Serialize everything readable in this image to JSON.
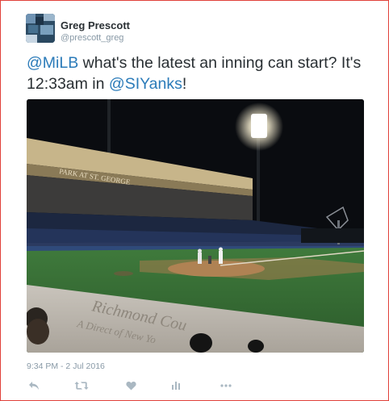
{
  "user": {
    "name": "Greg Prescott",
    "handle": "@prescott_greg"
  },
  "tweet": {
    "segments": [
      {
        "text": "@MiLB",
        "type": "mention"
      },
      {
        "text": " what's the latest an inning can start? It's 12:33am in ",
        "type": "text"
      },
      {
        "text": "@SIYanks",
        "type": "mention"
      },
      {
        "text": "!",
        "type": "text"
      }
    ],
    "timestamp": "9:34 PM - 2 Jul 2016"
  },
  "photo": {
    "stadium_sign": "PARK AT ST. GEORGE",
    "dugout_text_line1": "Richmond Cou",
    "dugout_text_line2": "A Direct of New Yo"
  },
  "actions": [
    {
      "icon": "reply-icon"
    },
    {
      "icon": "retweet-icon"
    },
    {
      "icon": "like-icon"
    },
    {
      "icon": "analytics-icon"
    },
    {
      "icon": "more-icon"
    }
  ],
  "colors": {
    "accent": "#2b7bb9",
    "muted": "#8899a6",
    "text": "#292f33",
    "frame_border": "#e0413a"
  }
}
